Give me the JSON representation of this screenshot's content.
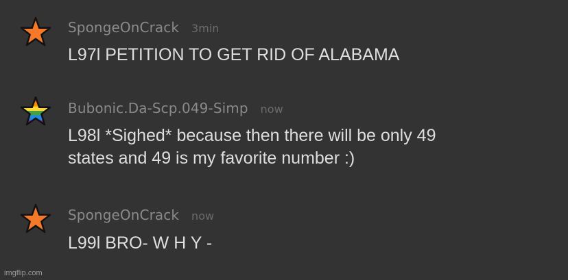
{
  "messages": [
    {
      "username": "SpongeOnCrack",
      "time": "3min",
      "lines": [
        "L97l PETITION TO GET RID OF ALABAMA"
      ],
      "avatar_icon": "orange-star-icon",
      "avatar_color": "#f47a2a"
    },
    {
      "username": "Bubonic.Da-Scp.049-Simp",
      "time": "now",
      "lines": [
        "L98l *Sighed* because then there will be only 49",
        "states and 49 is my favorite number :)"
      ],
      "avatar_icon": "rainbow-star-icon",
      "avatar_colors": [
        "#e53935",
        "#fb8c00",
        "#fdd835",
        "#43a047",
        "#1e88e5",
        "#8e24aa"
      ]
    },
    {
      "username": "SpongeOnCrack",
      "time": "now",
      "lines": [
        "L99l BRO- W H Y -"
      ],
      "avatar_icon": "orange-star-icon",
      "avatar_color": "#f47a2a"
    }
  ],
  "watermark": "imgflip.com",
  "colors": {
    "background": "#333333",
    "username": "#8a8a8a",
    "timestamp": "#6c6c6c",
    "message_text": "#dedede"
  }
}
